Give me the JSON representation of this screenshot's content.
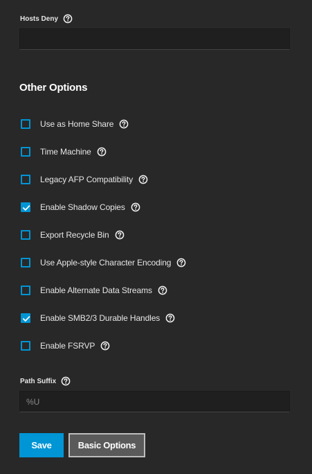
{
  "hosts_deny": {
    "label": "Hosts Deny",
    "value": "",
    "help_icon": "help-circle-icon"
  },
  "other_options": {
    "title": "Other Options",
    "items": [
      {
        "label": "Use as Home Share",
        "checked": false
      },
      {
        "label": "Time Machine",
        "checked": false
      },
      {
        "label": "Legacy AFP Compatibility",
        "checked": false
      },
      {
        "label": "Enable Shadow Copies",
        "checked": true
      },
      {
        "label": "Export Recycle Bin",
        "checked": false
      },
      {
        "label": "Use Apple-style Character Encoding",
        "checked": false
      },
      {
        "label": "Enable Alternate Data Streams",
        "checked": false
      },
      {
        "label": "Enable SMB2/3 Durable Handles",
        "checked": true
      },
      {
        "label": "Enable FSRVP",
        "checked": false
      }
    ]
  },
  "path_suffix": {
    "label": "Path Suffix",
    "value": "%U"
  },
  "actions": {
    "save_label": "Save",
    "basic_label": "Basic Options"
  },
  "colors": {
    "background": "#282828",
    "accent": "#0095d5",
    "input_bg": "#1f1f1f",
    "secondary_button": "#5a5a5a"
  }
}
